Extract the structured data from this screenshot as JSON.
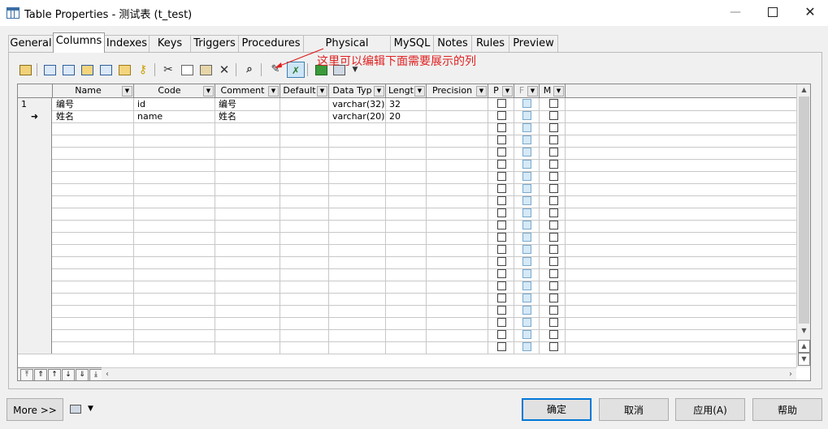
{
  "window": {
    "title": "Table Properties - 测试表 (t_test)",
    "min_glyph": "—",
    "close_glyph": "✕"
  },
  "tabs": [
    "General",
    "Columns",
    "Indexes",
    "Keys",
    "Triggers",
    "Procedures",
    "Physical Options",
    "MySQL",
    "Notes",
    "Rules",
    "Preview"
  ],
  "active_tab": "Columns",
  "toolbar": {
    "icons": [
      "properties-icon",
      "insert-row-icon",
      "add-row-icon",
      "add-column-icon",
      "add-columns-icon",
      "paste-column-icon",
      "key-icon",
      "cut-icon",
      "copy-icon",
      "paste-icon",
      "delete-icon",
      "find-icon",
      "customize-columns-icon",
      "filter-icon",
      "excel-export-icon",
      "print-icon"
    ]
  },
  "annotation": "这里可以编辑下面需要展示的列",
  "grid": {
    "columns": [
      "Name",
      "Code",
      "Comment",
      "Default",
      "Data Typ",
      "Lengt",
      "Precision",
      "P",
      "F",
      "M"
    ],
    "rows": [
      {
        "marker": "1",
        "name": "编号",
        "code": "id",
        "comment": "编号",
        "default": "",
        "data_type": "varchar(32)",
        "length": "32",
        "precision": ""
      },
      {
        "marker": "➜",
        "name": "姓名",
        "code": "name",
        "comment": "姓名",
        "default": "",
        "data_type": "varchar(20)",
        "length": "20",
        "precision": ""
      }
    ],
    "empty_rows": 19
  },
  "footer": {
    "more_label": "More >>",
    "ok_label": "确定",
    "cancel_label": "取消",
    "apply_label": "应用(A)",
    "help_label": "帮助"
  }
}
